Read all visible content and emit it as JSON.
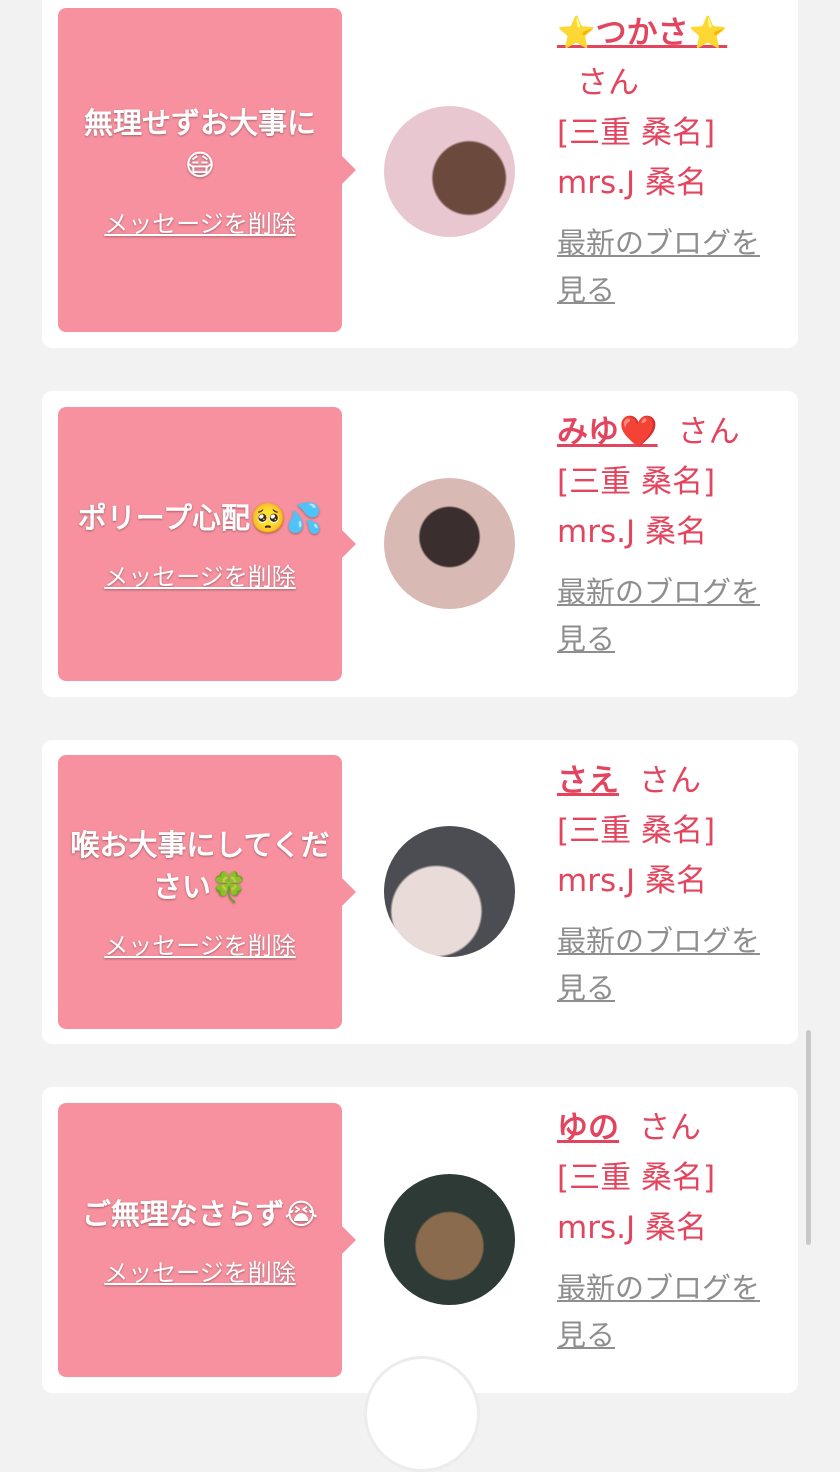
{
  "cards": [
    {
      "message": "無理せずお大事に😷",
      "delete_label": "メッセージを削除",
      "name": "⭐つかさ⭐",
      "san": "さん",
      "location": "[三重 桑名] mrs.J 桑名",
      "blog_label": "最新のブログを見る",
      "avatar_colors": [
        "#e9c7d1",
        "#6b4a3d"
      ]
    },
    {
      "message": "ポリープ心配🥺💦",
      "delete_label": "メッセージを削除",
      "name": "みゆ❤️",
      "san": "さん",
      "location": "[三重 桑名] mrs.J 桑名",
      "blog_label": "最新のブログを見る",
      "avatar_colors": [
        "#d9b9b3",
        "#3a2e2f"
      ]
    },
    {
      "message": "喉お大事にしてください🍀",
      "delete_label": "メッセージを削除",
      "name": "さえ",
      "san": "さん",
      "location": "[三重 桑名] mrs.J 桑名",
      "blog_label": "最新のブログを見る",
      "avatar_colors": [
        "#e8dbd8",
        "#4b4d52"
      ]
    },
    {
      "message": "ご無理なさらず😭",
      "delete_label": "メッセージを削除",
      "name": "ゆの",
      "san": "さん",
      "location": "[三重 桑名] mrs.J 桑名",
      "blog_label": "最新のブログを見る",
      "avatar_colors": [
        "#8a6b4e",
        "#2d3a35"
      ]
    }
  ]
}
